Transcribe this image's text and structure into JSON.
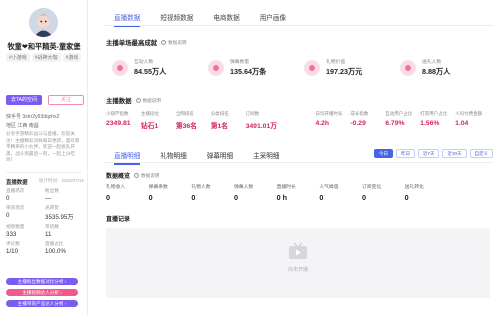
{
  "profile": {
    "nickname": "牧童❤和平精英-童家堡",
    "tags": [
      "#小游戏",
      "#战神大咖",
      "#游戏"
    ],
    "follow_label": "去TA的空间",
    "unfollow_label": "关注",
    "account_id": "快手号 3xtrr2y93dqzhx2",
    "location_label": "地区",
    "location": "江西 南昌",
    "description": "分享手游精彩战斗与直播，欢迎关注！主播精彩对局每日更新，喜欢和平精英的小伙伴，欢迎一起组队开黑，战斗到最后一刻，一起上分吃鸡！",
    "stats_title": "直播数据",
    "stats_time": "统计时间：2020/07/15",
    "stats": [
      {
        "label": "直播场次",
        "value": "0"
      },
      {
        "label": "粉丝数",
        "value": "—"
      },
      {
        "label": "带货场次",
        "value": "0"
      },
      {
        "label": "总获赞",
        "value": "3535.95万"
      },
      {
        "label": "视频数量",
        "value": "333"
      },
      {
        "label": "带货数",
        "value": "11"
      },
      {
        "label": "评论数",
        "value": "1/10"
      },
      {
        "label": "直播占比",
        "value": "100.0%"
      }
    ],
    "actions": [
      {
        "label": "主播粉丝数据对比分析 ›",
        "color": "#7b5cf0"
      },
      {
        "label": "主播视频达人分析 ›",
        "color": "#ef5a8e"
      },
      {
        "label": "主播带货产品达人分析 ›",
        "color": "#7b5cf0"
      }
    ]
  },
  "tabs": [
    "直播数据",
    "短视频数据",
    "电商数据",
    "用户画像"
  ],
  "highlights": {
    "title": "主播单场最高成就",
    "info_label": "数据说明",
    "cards": [
      {
        "label": "互动人数",
        "value": "84.55万人"
      },
      {
        "label": "弹幕数量",
        "value": "135.64万条"
      },
      {
        "label": "礼物价值",
        "value": "197.23万元"
      },
      {
        "label": "送礼人数",
        "value": "8.88万人"
      }
    ]
  },
  "anchor_data": {
    "title": "主播数据",
    "info_label": "数据说明",
    "metrics": [
      {
        "label": "小葫芦指数",
        "value": "2349.81"
      },
      {
        "label": "主播段位",
        "value": "钻石1"
      },
      {
        "label": "全网排名",
        "value": "第36名"
      },
      {
        "label": "分类排名",
        "value": "第1名"
      },
      {
        "label": "订阅数",
        "value": "3491.01万"
      },
      {
        "label": "日均开播时长",
        "value": "4.2h"
      },
      {
        "label": "成长指数",
        "value": "-0.29"
      },
      {
        "label": "互动用户占比",
        "value": "6.79%"
      },
      {
        "label": "打赏用户占比",
        "value": "1.56%"
      },
      {
        "label": "人均付费金额",
        "value": "1.04"
      }
    ]
  },
  "subtabs": [
    "直播明细",
    "礼物明细",
    "弹幕明细",
    "主采明细"
  ],
  "range_buttons": [
    "今日",
    "昨日",
    "近7天",
    "近30天",
    "自定义"
  ],
  "overview": {
    "title": "数据概览",
    "info_label": "数据说明",
    "items": [
      {
        "label": "礼物收入",
        "value": "0"
      },
      {
        "label": "弹幕条数",
        "value": "0"
      },
      {
        "label": "礼物人数",
        "value": "0"
      },
      {
        "label": "弹幕人数",
        "value": "0"
      },
      {
        "label": "直播时长",
        "value": "0 h"
      },
      {
        "label": "人气峰值",
        "value": "0"
      },
      {
        "label": "订阅变化",
        "value": "0"
      },
      {
        "label": "送礼转化",
        "value": "0"
      }
    ]
  },
  "records": {
    "title": "直播记录",
    "empty_text": "尚未开播"
  },
  "icons": [
    "avatar-image",
    "trophy-icon",
    "tv-icon",
    "question-icon"
  ],
  "colors": {
    "accent": "#4a62e6",
    "highlight": "#d5255a",
    "purple": "#7b5cf0",
    "pink": "#ef5a8e"
  }
}
